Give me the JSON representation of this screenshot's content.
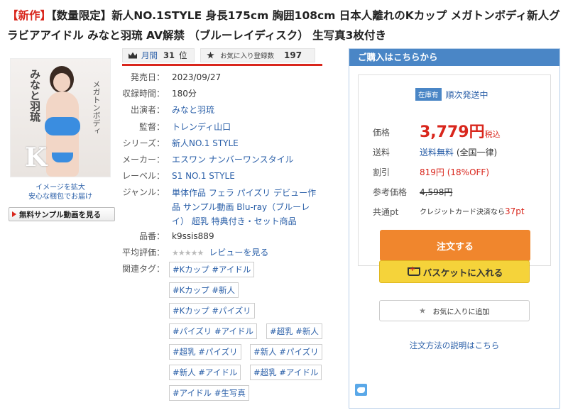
{
  "title": {
    "new_badge": "【新作】",
    "text": "【数量限定】新人NO.1STYLE 身長175cm 胸囲108cm 日本人離れのKカップ メガトンボディ新人グラビアアイドル みなと羽琉 AV解禁 （ブルーレイディスク） 生写真3枚付き"
  },
  "image": {
    "cover_text_left": "みなと羽琉",
    "cover_text_right": "メガトンボディ",
    "cover_kcup": "K",
    "caption_line1": "イメージを拡大",
    "caption_line2": "安心な梱包でお届け",
    "sample_button": "無料サンプル動画を見る"
  },
  "ranking": {
    "label": "月間",
    "rank": "31",
    "suffix": "位",
    "fav_label": "お気に入り登録数",
    "fav_count": "197"
  },
  "details": {
    "release_label": "発売日：",
    "release_value": "2023/09/27",
    "runtime_label": "収録時間：",
    "runtime_value": "180分",
    "cast_label": "出演者：",
    "cast_value": "みなと羽琉",
    "director_label": "監督：",
    "director_value": "トレンディ山口",
    "series_label": "シリーズ：",
    "series_value": "新人NO.1 STYLE",
    "maker_label": "メーカー：",
    "maker_value": "エスワン ナンバーワンスタイル",
    "label_label": "レーベル：",
    "label_value": "S1 NO.1 STYLE",
    "genre_label": "ジャンル：",
    "genre_value": "単体作品 フェラ パイズリ デビュー作品 サンプル動画 Blu-ray（ブルーレイ） 超乳 特典付き・セット商品",
    "code_label": "品番：",
    "code_value": "k9ssis889",
    "rating_label": "平均評価：",
    "rating_stars": "★★★★★",
    "rating_link": "レビューを見る",
    "tags_label": "関連タグ："
  },
  "tags": [
    "#Kカップ #アイドル",
    "#Kカップ #新人",
    "#Kカップ #パイズリ",
    "#パイズリ #アイドル",
    "#超乳 #新人",
    "#超乳 #パイズリ",
    "#新人 #パイズリ",
    "#新人 #アイドル",
    "#超乳 #アイドル",
    "#アイドル #生写真"
  ],
  "purchase": {
    "header": "ご購入はこちらから",
    "stock_badge": "在庫有",
    "shipping_status": "順次発送中",
    "price_label": "価格",
    "price_value": "3,779円",
    "price_tax": "税込",
    "shipping_label": "送料",
    "shipping_link": "送料無料",
    "shipping_note": "(全国一律)",
    "discount_label": "割引",
    "discount_value": "819円 (18%OFF)",
    "list_label": "参考価格",
    "list_value": "4,598円",
    "points_label": "共通pt",
    "points_note": "クレジットカード決済なら",
    "points_value": "37pt",
    "order_button": "注文する",
    "basket_button": "バスケットに入れる",
    "favorite_button": "お気に入りに追加",
    "howto_link": "注文方法の説明はこちら"
  },
  "colors": {
    "accent_red": "#d9261c",
    "link_blue": "#2a5fa8",
    "panel_blue": "#4a86c6",
    "order_orange": "#f0862d",
    "basket_yellow": "#f5d33a"
  }
}
